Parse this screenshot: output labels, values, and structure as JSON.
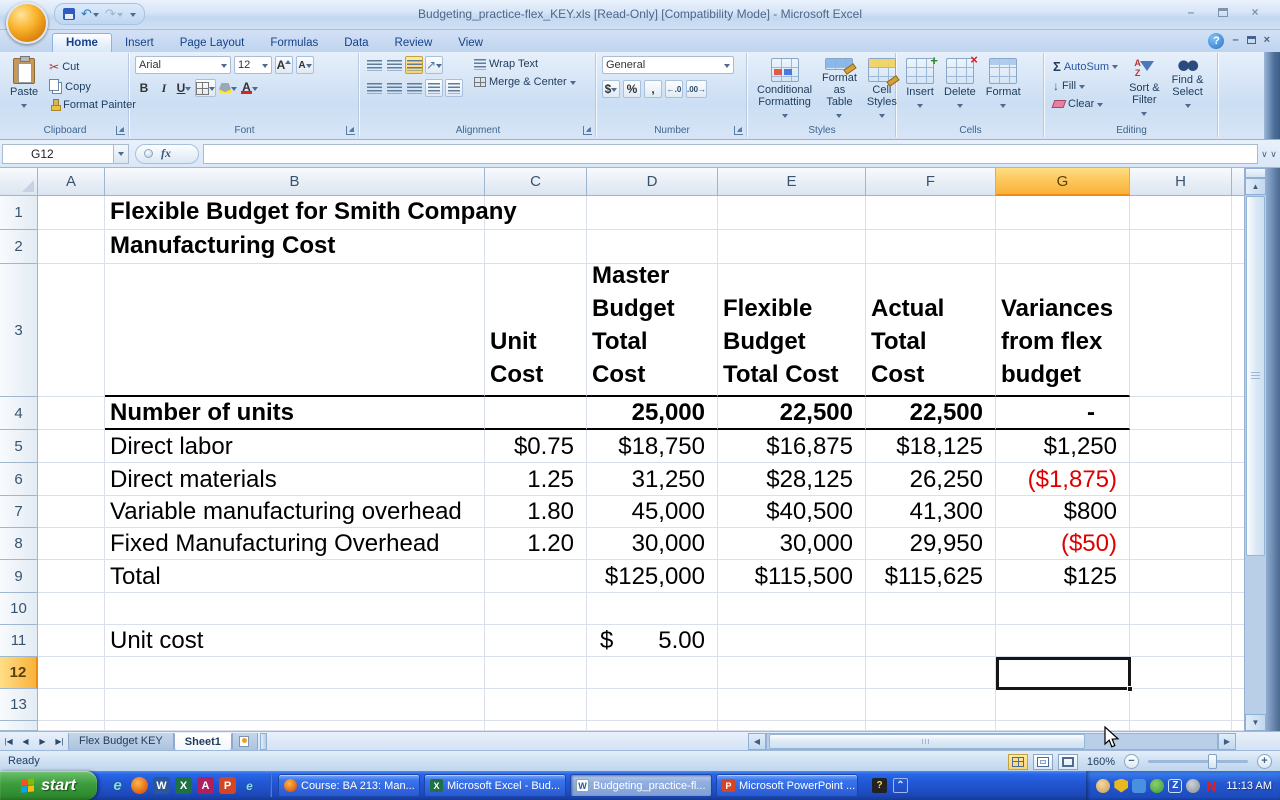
{
  "titlebar": {
    "title": "Budgeting_practice-flex_KEY.xls  [Read-Only]  [Compatibility Mode] - Microsoft Excel"
  },
  "ribbon": {
    "tabs": [
      "Home",
      "Insert",
      "Page Layout",
      "Formulas",
      "Data",
      "Review",
      "View"
    ],
    "active_tab": "Home",
    "clipboard": {
      "title": "Clipboard",
      "paste": "Paste",
      "cut": "Cut",
      "copy": "Copy",
      "format_painter": "Format Painter"
    },
    "font": {
      "title": "Font",
      "family": "Arial",
      "size": "12",
      "bold": "B",
      "italic": "I",
      "underline": "U",
      "grow": "A",
      "shrink": "A",
      "color_letter": "A"
    },
    "alignment": {
      "title": "Alignment",
      "wrap_text": "Wrap Text",
      "merge_center": "Merge & Center"
    },
    "number": {
      "title": "Number",
      "format": "General",
      "currency": "$",
      "percent": "%",
      "comma": ","
    },
    "styles": {
      "title": "Styles",
      "conditional": "Conditional\nFormatting",
      "format_table": "Format\nas Table",
      "cell_styles": "Cell\nStyles"
    },
    "cells": {
      "title": "Cells",
      "insert": "Insert",
      "delete": "Delete",
      "format": "Format"
    },
    "editing": {
      "title": "Editing",
      "autosum": "AutoSum",
      "fill": "Fill",
      "clear": "Clear",
      "sort_filter": "Sort &\nFilter",
      "find_select": "Find &\nSelect"
    }
  },
  "formula_bar": {
    "name_box": "G12",
    "fx": "fx",
    "formula": ""
  },
  "grid": {
    "col_headers": [
      "A",
      "B",
      "C",
      "D",
      "E",
      "F",
      "G",
      "H"
    ],
    "row_headers": [
      "1",
      "2",
      "3",
      "4",
      "5",
      "6",
      "7",
      "8",
      "9",
      "10",
      "11",
      "12",
      "13"
    ],
    "selected_cell": "G12",
    "selected_column": "G",
    "selected_row": "12"
  },
  "cells": {
    "b1": "Flexible Budget for Smith Company",
    "b2": "Manufacturing Cost",
    "c3": "Unit\nCost",
    "d3": "Master\nBudget\nTotal\nCost",
    "e3": "Flexible\nBudget\nTotal Cost",
    "f3": "Actual\nTotal\nCost",
    "g3": "Variances\nfrom flex\nbudget",
    "b4": "Number of units",
    "d4": "25,000",
    "e4": "22,500",
    "f4": "22,500",
    "g4": "-",
    "b5": "Direct labor",
    "c5": "$0.75",
    "d5": "$18,750",
    "e5": "$16,875",
    "f5": "$18,125",
    "g5": "$1,250",
    "b6": "Direct materials",
    "c6": "1.25",
    "d6": "31,250",
    "e6": "$28,125",
    "f6": "26,250",
    "g6": "($1,875)",
    "b7": "Variable manufacturing overhead",
    "c7": "1.80",
    "d7": "45,000",
    "e7": "$40,500",
    "f7": "41,300",
    "g7": "$800",
    "b8": "Fixed Manufacturing Overhead",
    "c8": "1.20",
    "d8": "30,000",
    "e8": "30,000",
    "f8": "29,950",
    "g8": "($50)",
    "b9": "Total",
    "d9": "$125,000",
    "e9": "$115,500",
    "f9": "$115,625",
    "g9": "$125",
    "b11": "Unit cost",
    "d11_currency": "$",
    "d11_value": "5.00"
  },
  "sheet_tabs": {
    "tab1": "Flex Budget KEY",
    "tab2": "Sheet1",
    "active": "Sheet1"
  },
  "status_bar": {
    "mode": "Ready",
    "zoom": "160%"
  },
  "taskbar": {
    "start": "start",
    "buttons": [
      {
        "label": "Course: BA 213: Man..."
      },
      {
        "label": "Microsoft Excel - Bud..."
      },
      {
        "label": "Budgeting_practice-fl..."
      },
      {
        "label": "Microsoft PowerPoint ..."
      }
    ],
    "clock": "11:13 AM"
  },
  "glyphs": {
    "sigma": "Σ",
    "cut": "✂",
    "undo": "↶",
    "redo": "↷",
    "close": "×",
    "min": "–",
    "help": "?",
    "left": "◀",
    "right": "▶",
    "up": "▲",
    "down": "▼",
    "chevron": "∨ ∨",
    "word_w": "W",
    "excel_x": "X",
    "access_a": "A",
    "ppt_p": "P",
    "ie_e": "e",
    "z": "Z",
    "n": "N",
    "fill_arrow": "↓",
    "orient": "↗"
  },
  "colors": {
    "selection_header": "#fbbf4c",
    "negative_value": "#dd0000",
    "selection_border": "#000000",
    "taskbar_blue": "#2258d6"
  }
}
